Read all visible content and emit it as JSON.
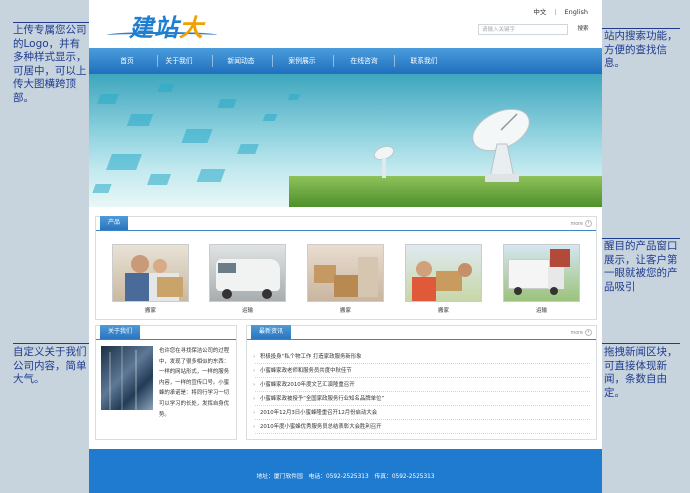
{
  "annotations": {
    "logo": "上传专属您公司的Logo，并有多种样式显示，可居中，可以上传大图横跨顶部。",
    "search": "站内搜索功能，方便的查找信息。",
    "products": "醒目的产品窗口展示，让客户第一眼就被您的产品吸引",
    "about": "自定义关于我们公司内容，简单大气。",
    "news": "拖拽新闻区块，可直接体现新闻，条数自由定。"
  },
  "logo": {
    "text_a": "建站",
    "text_b": "大师"
  },
  "lang": {
    "zh": "中文",
    "sep": "|",
    "en": "English"
  },
  "search": {
    "placeholder": "请输入关键字",
    "button": "搜索"
  },
  "nav": [
    "首页",
    "关于我们",
    "新闻动态",
    "案例展示",
    "在线咨询",
    "联系我们"
  ],
  "products": {
    "title": "产品",
    "more": "more",
    "items": [
      "搬家",
      "运输",
      "搬家",
      "搬家",
      "运输"
    ]
  },
  "about": {
    "title": "关于我们",
    "text": "也许您在寻找保洁公司的过程中，发现了很多相似的东西：一样的网站形式，一样的服务内容，一样的宣传口号。小蜜蜂的承诺是：将同行学习一切可以学习的长处，发挥自身优势。"
  },
  "news": {
    "title": "最新资讯",
    "more": "more",
    "items": [
      "积极投身“私个物工作 打造家政服务新形象",
      "小蜜蜂家政老师和服务员共度中秋佳节",
      "小蜜蜂家政2010年度文艺汇演隆重召开",
      "小蜜蜂家政被授予“全国家政服务行业知名品牌单位”",
      "2010年12月3日小蜜蜂隆重召开12月份启动大会",
      "2010年度小蜜蜂优秀服务员总结表彰大会胜利召开"
    ]
  },
  "footer": "地址：厦门软件园　电话：0592-2525313　传真：0592-2525313",
  "colors": {
    "nav": "#2a7cc6",
    "footer": "#1f7bd0",
    "annotation": "#1f3b8f"
  }
}
